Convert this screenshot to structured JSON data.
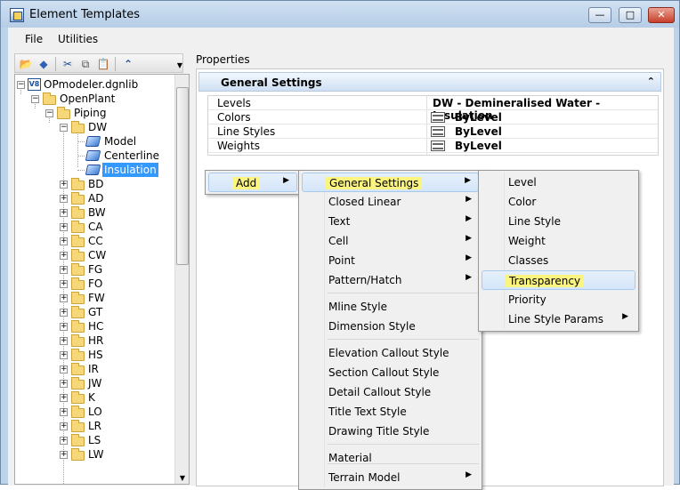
{
  "window": {
    "title": "Element Templates",
    "controls": {
      "minimize": "—",
      "maximize": "□",
      "close": "✕"
    }
  },
  "menubar": [
    "File",
    "Utilities"
  ],
  "toolbar": {
    "icons": [
      "open-folder-icon",
      "template-icon",
      "cut-icon",
      "copy-icon",
      "paste-icon",
      "chevron-up-icon"
    ]
  },
  "tree": {
    "library": "OPmodeler.dgnlib",
    "root": "OpenPlant",
    "group": "Piping",
    "open_folder": "DW",
    "templates": [
      "Model",
      "Centerline",
      "Insulation"
    ],
    "selected_template": "Insulation",
    "folders": [
      "BD",
      "AD",
      "BW",
      "CA",
      "CC",
      "CW",
      "FG",
      "FO",
      "FW",
      "GT",
      "HC",
      "HR",
      "HS",
      "IR",
      "JW",
      "K",
      "LO",
      "LR",
      "LS",
      "LW"
    ]
  },
  "properties": {
    "title": "Properties",
    "section": "General Settings",
    "rows": [
      {
        "name": "Levels",
        "value": "DW - Demineralised Water - Insulation",
        "icon": false
      },
      {
        "name": "Colors",
        "value": "ByLevel",
        "icon": true
      },
      {
        "name": "Line Styles",
        "value": "ByLevel",
        "icon": true
      },
      {
        "name": "Weights",
        "value": "ByLevel",
        "icon": true
      }
    ]
  },
  "menus": {
    "add_menu": {
      "items": [
        "Add"
      ]
    },
    "categories": {
      "items": [
        "General Settings",
        "Closed Linear",
        "Text",
        "Cell",
        "Point",
        "Pattern/Hatch",
        "Mline Style",
        "Dimension Style",
        "Elevation Callout Style",
        "Section Callout Style",
        "Detail Callout Style",
        "Title Text Style",
        "Drawing Title Style",
        "Material",
        "Terrain Model"
      ]
    },
    "general_settings": {
      "items": [
        "Level",
        "Color",
        "Line Style",
        "Weight",
        "Classes",
        "Transparency",
        "Priority",
        "Line Style Params"
      ]
    }
  }
}
